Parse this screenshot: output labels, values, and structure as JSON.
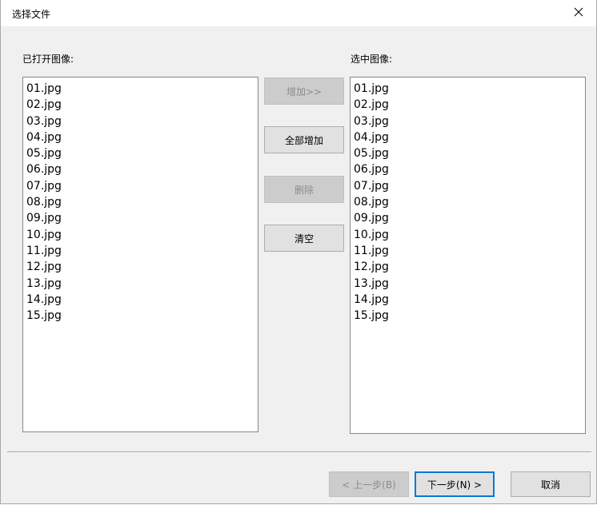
{
  "window": {
    "title": "选择文件",
    "close_glyph": "✕"
  },
  "left_panel": {
    "label": "已打开图像:",
    "items": [
      "01.jpg",
      "02.jpg",
      "03.jpg",
      "04.jpg",
      "05.jpg",
      "06.jpg",
      "07.jpg",
      "08.jpg",
      "09.jpg",
      "10.jpg",
      "11.jpg",
      "12.jpg",
      "13.jpg",
      "14.jpg",
      "15.jpg"
    ]
  },
  "right_panel": {
    "label": "选中图像:",
    "items": [
      "01.jpg",
      "02.jpg",
      "03.jpg",
      "04.jpg",
      "05.jpg",
      "06.jpg",
      "07.jpg",
      "08.jpg",
      "09.jpg",
      "10.jpg",
      "11.jpg",
      "12.jpg",
      "13.jpg",
      "14.jpg",
      "15.jpg"
    ]
  },
  "actions": {
    "add": "增加>>",
    "add_all": "全部增加",
    "delete": "删除",
    "clear": "清空"
  },
  "footer": {
    "back": "< 上一步(B)",
    "next": "下一步(N) >",
    "cancel": "取消"
  }
}
